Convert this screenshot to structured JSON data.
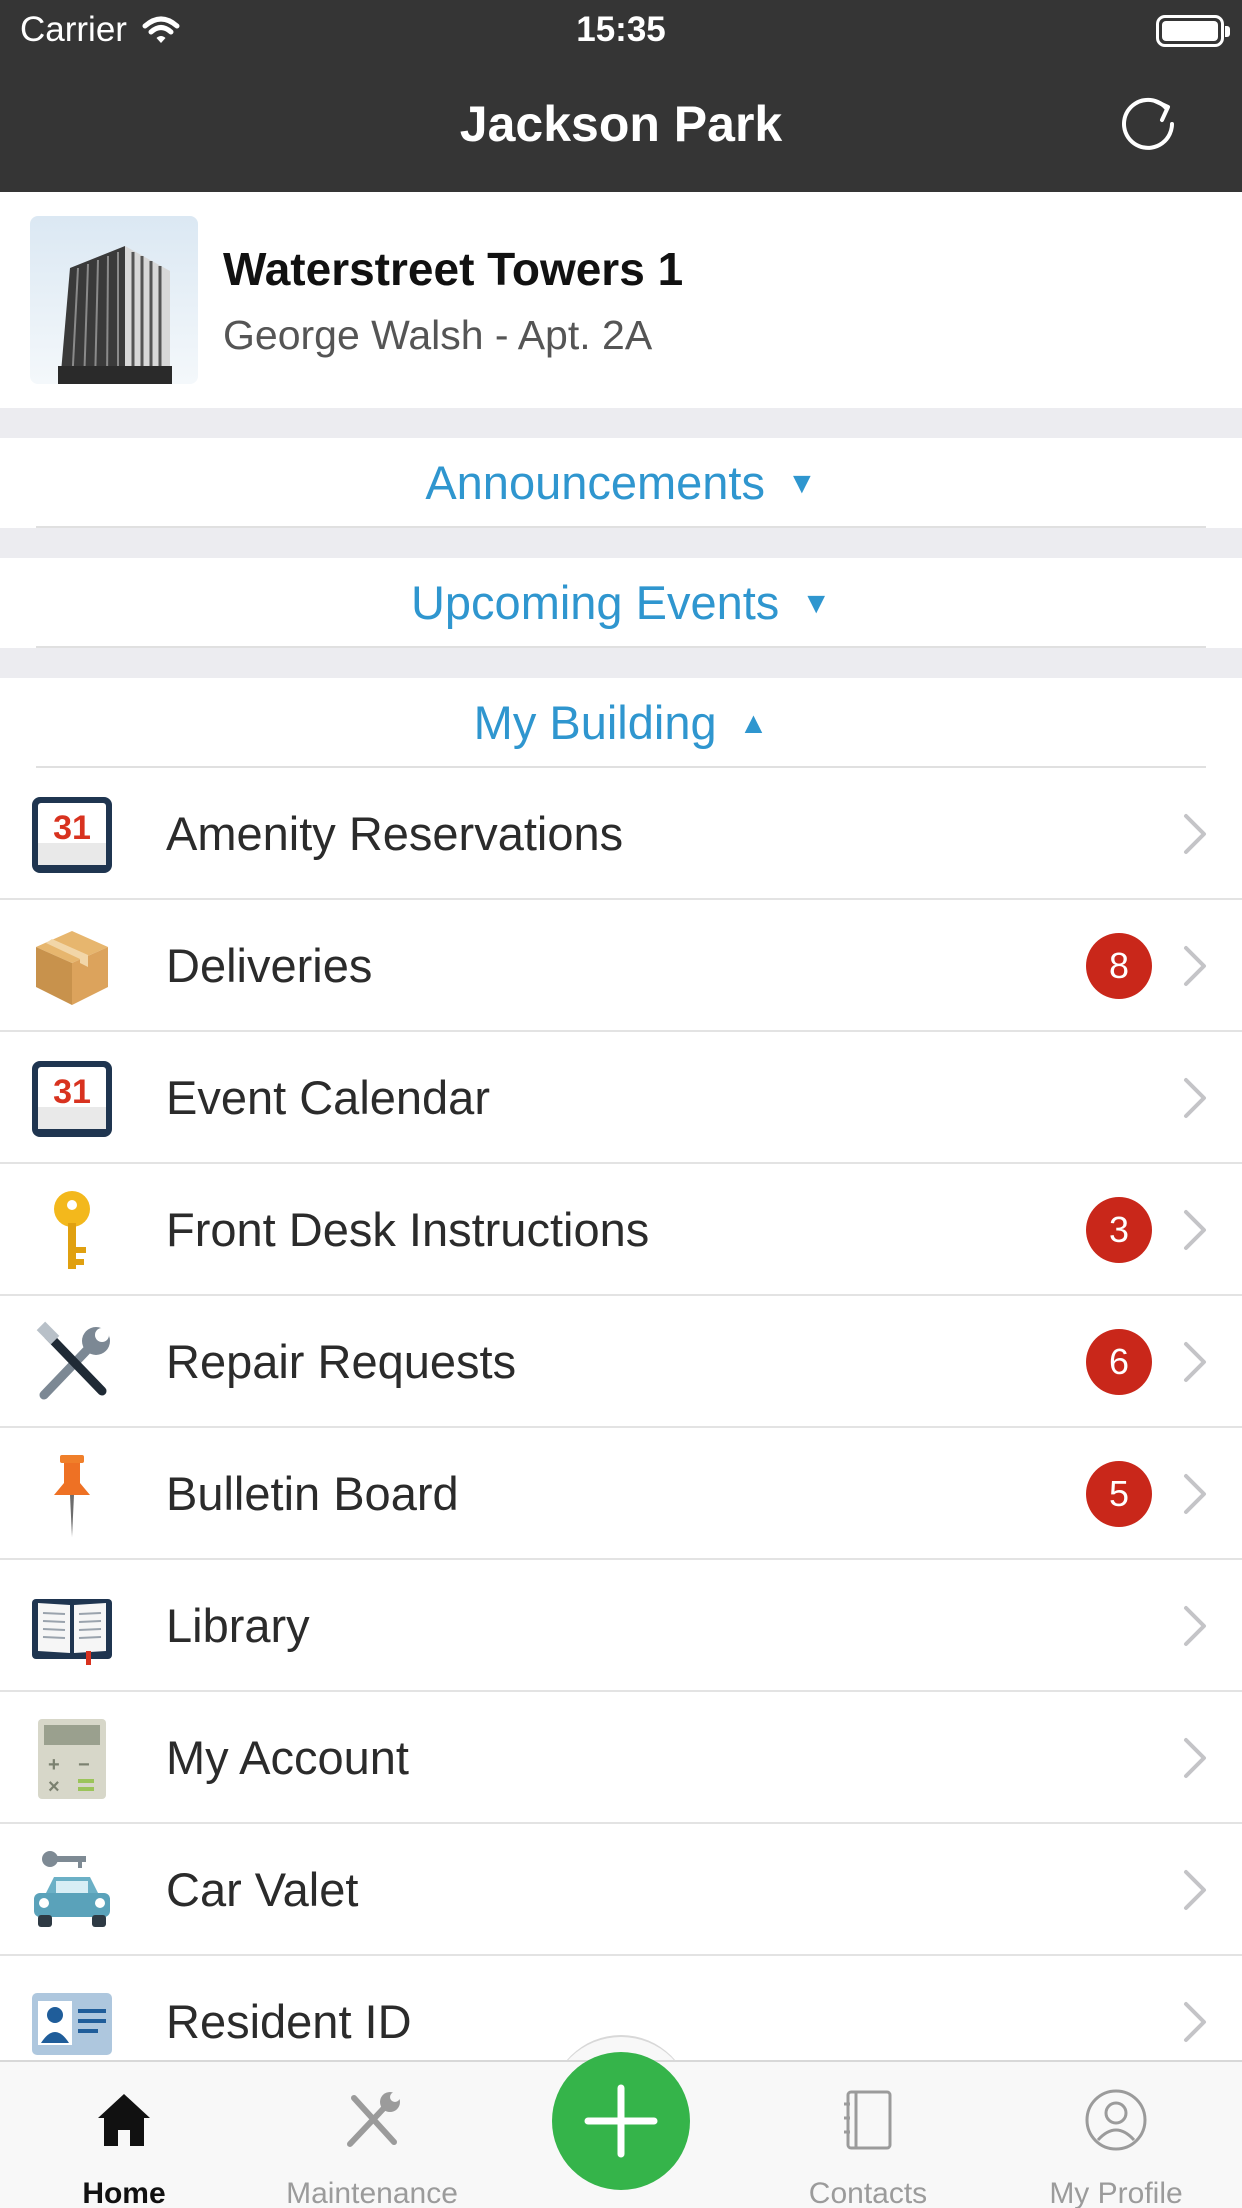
{
  "status_bar": {
    "carrier": "Carrier",
    "time": "15:35"
  },
  "nav": {
    "title": "Jackson Park",
    "refresh_icon": "refresh-icon"
  },
  "building": {
    "name": "Waterstreet Towers 1",
    "subtitle": "George Walsh - Apt.  2A"
  },
  "sections": {
    "announcements": {
      "label": "Announcements",
      "state": "▼"
    },
    "upcoming_events": {
      "label": "Upcoming Events",
      "state": "▼"
    },
    "my_building": {
      "label": "My Building",
      "state": "▲"
    }
  },
  "items": [
    {
      "label": "Amenity Reservations",
      "icon": "calendar-icon",
      "badge": ""
    },
    {
      "label": "Deliveries",
      "icon": "package-icon",
      "badge": "8"
    },
    {
      "label": "Event Calendar",
      "icon": "calendar-icon",
      "badge": ""
    },
    {
      "label": "Front Desk Instructions",
      "icon": "key-icon",
      "badge": "3"
    },
    {
      "label": "Repair Requests",
      "icon": "tools-icon",
      "badge": "6"
    },
    {
      "label": "Bulletin Board",
      "icon": "pushpin-icon",
      "badge": "5"
    },
    {
      "label": "Library",
      "icon": "book-icon",
      "badge": ""
    },
    {
      "label": "My Account",
      "icon": "calculator-icon",
      "badge": ""
    },
    {
      "label": "Car Valet",
      "icon": "car-key-icon",
      "badge": ""
    },
    {
      "label": "Resident ID",
      "icon": "id-card-icon",
      "badge": ""
    }
  ],
  "calendar_day": "31",
  "tabbar": {
    "home": "Home",
    "maintenance": "Maintenance",
    "contacts": "Contacts",
    "profile": "My Profile"
  },
  "colors": {
    "accent": "#2f96cf",
    "badge": "#c9271a",
    "fab": "#35b44a",
    "navbar": "#353535"
  }
}
